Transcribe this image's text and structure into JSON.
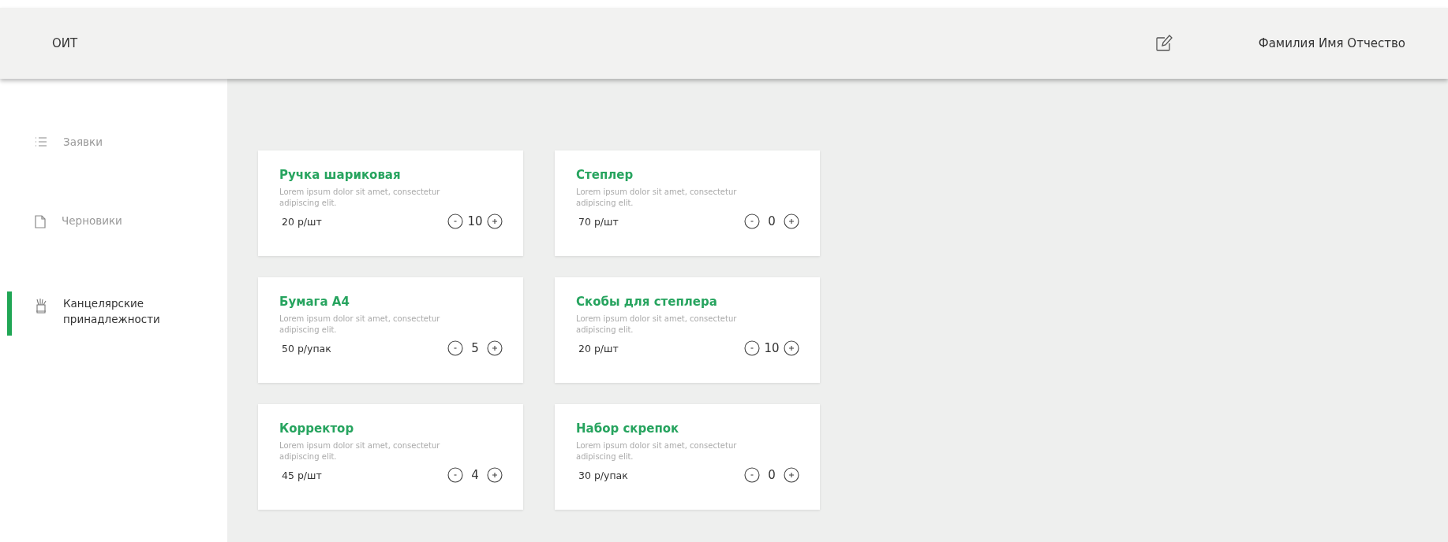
{
  "header": {
    "logo": "ОИТ",
    "user_name": "Фамилия Имя Отчество"
  },
  "sidebar": {
    "items": [
      {
        "label": "Заявки",
        "selected": false
      },
      {
        "label": "Черновики",
        "selected": false
      },
      {
        "label": "Канцелярские принадлежности",
        "selected": true
      }
    ]
  },
  "products": [
    {
      "name": "Ручка шариковая",
      "description": "Lorem ipsum dolor sit amet, consectetur adipiscing elit.",
      "price": "20 р/шт",
      "quantity": "10"
    },
    {
      "name": "Степлер",
      "description": "Lorem ipsum dolor sit amet, consectetur adipiscing elit.",
      "price": "70 р/шт",
      "quantity": "0"
    },
    {
      "name": "Бумага А4",
      "description": "Lorem ipsum dolor sit amet, consectetur adipiscing elit.",
      "price": "50 р/упак",
      "quantity": "5"
    },
    {
      "name": "Скобы для степлера",
      "description": "Lorem ipsum dolor sit amet, consectetur adipiscing elit.",
      "price": "20 р/шт",
      "quantity": "10"
    },
    {
      "name": "Корректор",
      "description": "Lorem ipsum dolor sit amet, consectetur adipiscing elit.",
      "price": "45 р/шт",
      "quantity": "4"
    },
    {
      "name": "Набор скрепок",
      "description": "Lorem ipsum dolor sit amet, consectetur adipiscing elit.",
      "price": "30 р/упак",
      "quantity": "0"
    }
  ]
}
